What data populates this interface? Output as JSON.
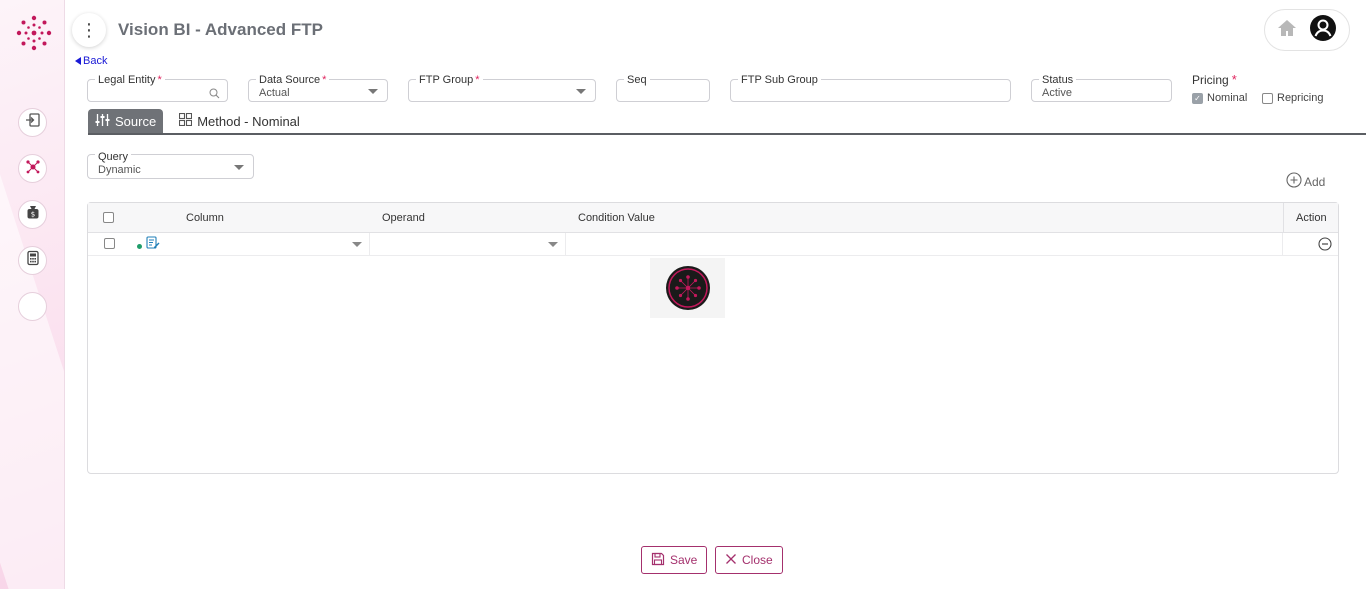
{
  "header": {
    "title": "Vision BI - Advanced FTP",
    "menu_glyph": "⋮",
    "back_label": "Back"
  },
  "sidebar": {
    "items": [
      {
        "icon": "login-icon"
      },
      {
        "icon": "network-icon"
      },
      {
        "icon": "money-bag-icon"
      },
      {
        "icon": "calculator-icon"
      },
      {
        "icon": "empty"
      }
    ]
  },
  "form": {
    "legal_entity": {
      "label": "Legal Entity",
      "required": "*",
      "value": ""
    },
    "data_source": {
      "label": "Data Source",
      "required": "*",
      "value": "Actual"
    },
    "ftp_group": {
      "label": "FTP Group",
      "required": "*",
      "value": ""
    },
    "seq": {
      "label": "Seq",
      "value": ""
    },
    "ftp_sub_group": {
      "label": "FTP Sub Group",
      "value": ""
    },
    "status": {
      "label": "Status",
      "value": "Active"
    },
    "pricing": {
      "label": "Pricing",
      "required": "*",
      "options": [
        {
          "label": "Nominal",
          "checked": true
        },
        {
          "label": "Repricing",
          "checked": false
        }
      ]
    }
  },
  "tabs": [
    {
      "label": "Source",
      "active": true
    },
    {
      "label": "Method - Nominal",
      "active": false
    }
  ],
  "query": {
    "label": "Query",
    "value": "Dynamic"
  },
  "add_label": "Add",
  "grid": {
    "columns": [
      "Column",
      "Operand",
      "Condition Value",
      "Action"
    ],
    "rows": [
      {
        "column": "",
        "operand": "",
        "condition_value": ""
      }
    ]
  },
  "footer": {
    "save_label": "Save",
    "close_label": "Close"
  },
  "colors": {
    "brand": "#a4306d",
    "required": "#e0245e",
    "tab_active": "#6f7277",
    "link": "#1a1ad6"
  }
}
